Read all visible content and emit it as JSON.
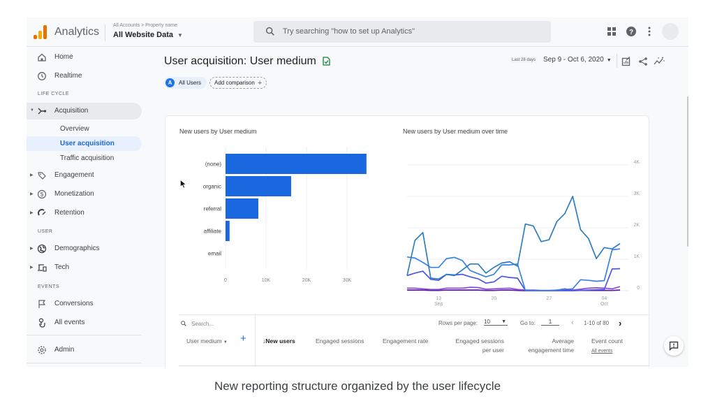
{
  "header": {
    "app_name": "Analytics",
    "breadcrumb": "All Accounts > Property name",
    "property_selector": "All Website Data",
    "search_placeholder": "Try searching \"how to set up Analytics\"",
    "icons": [
      "apps-grid-icon",
      "help-icon",
      "more-vert-icon",
      "account-avatar"
    ]
  },
  "sidebar": {
    "items_top": [
      {
        "label": "Home",
        "icon": "home-icon"
      },
      {
        "label": "Realtime",
        "icon": "clock-icon"
      }
    ],
    "section_lifecycle": "LIFE CYCLE",
    "acquisition": {
      "label": "Acquisition",
      "icon": "acquisition-icon",
      "expanded": true
    },
    "acquisition_children": [
      "Overview",
      "User acquisition",
      "Traffic acquisition"
    ],
    "selected": "User acquisition",
    "lifecycle_items": [
      {
        "label": "Engagement",
        "icon": "tag-icon"
      },
      {
        "label": "Monetization",
        "icon": "dollar-icon"
      },
      {
        "label": "Retention",
        "icon": "magnet-icon"
      }
    ],
    "section_user": "USER",
    "user_items": [
      {
        "label": "Demographics",
        "icon": "globe-icon"
      },
      {
        "label": "Tech",
        "icon": "devices-icon"
      }
    ],
    "section_events": "EVENTS",
    "event_items": [
      {
        "label": "Conversions",
        "icon": "flag-icon"
      },
      {
        "label": "All events",
        "icon": "touch-icon"
      }
    ],
    "admin": {
      "label": "Admin",
      "icon": "gear-icon"
    }
  },
  "page": {
    "title": "User acquisition: User medium",
    "segment_chip_letter": "A",
    "segment_chip": "All Users",
    "add_comparison": "Add comparison",
    "date_badge": "Last 28 days",
    "date_range": "Sep 9 - Oct 6, 2020"
  },
  "chart_data": [
    {
      "type": "bar",
      "orientation": "horizontal",
      "title": "New users by User medium",
      "categories": [
        "(none)",
        "organic",
        "referral",
        "affiliate",
        "email"
      ],
      "values": [
        34800,
        16200,
        8100,
        1000,
        50
      ],
      "xticks": [
        "0",
        "10K",
        "20K",
        "30K"
      ],
      "xlim": [
        0,
        35000
      ],
      "color": "#1a67e0",
      "grid": true
    },
    {
      "type": "line",
      "title": "New users by User medium over time",
      "x_start": "Sep 9",
      "x_ticks": [
        {
          "day": 4,
          "label": "13",
          "sub": "Sep"
        },
        {
          "day": 11,
          "label": "20",
          "sub": ""
        },
        {
          "day": 18,
          "label": "27",
          "sub": ""
        },
        {
          "day": 25,
          "label": "04",
          "sub": "Oct"
        }
      ],
      "yticks": [
        "0",
        "1K",
        "2K",
        "3K",
        "4K"
      ],
      "ylim": [
        0,
        4000
      ],
      "y_axis_side": "right",
      "legend_position": "bottom",
      "series": [
        {
          "name": "(none)",
          "color": "#2e7dbf",
          "values": [
            480,
            1600,
            1850,
            400,
            370,
            520,
            480,
            660,
            850,
            850,
            560,
            740,
            880,
            920,
            780,
            2120,
            2060,
            1560,
            1620,
            2200,
            2450,
            3000,
            1940,
            1660,
            1020,
            1370,
            1330,
            1500
          ]
        },
        {
          "name": "organic",
          "color": "#3883e6",
          "values": [
            1070,
            1040,
            900,
            740,
            740,
            1020,
            1060,
            960,
            640,
            540,
            440,
            520,
            820,
            820,
            850,
            10,
            0,
            0,
            0,
            20,
            40,
            60,
            350,
            330,
            300,
            320,
            1300,
            1330
          ]
        },
        {
          "name": "referral",
          "color": "#4a56e8",
          "values": [
            480,
            560,
            620,
            360,
            330,
            520,
            500,
            520,
            440,
            380,
            240,
            280,
            460,
            420,
            400,
            10,
            0,
            0,
            0,
            0,
            0,
            0,
            10,
            20,
            30,
            40,
            690,
            700
          ]
        },
        {
          "name": "affiliate",
          "color": "#8a4be0",
          "values": [
            80,
            80,
            60,
            40,
            40,
            80,
            80,
            80,
            110,
            100,
            50,
            60,
            70,
            80,
            40,
            20,
            20,
            10,
            10,
            20,
            60,
            20,
            50,
            80,
            90,
            80,
            60,
            130
          ]
        },
        {
          "name": "email",
          "color": "#5a1d9c",
          "values": [
            20,
            20,
            20,
            10,
            10,
            20,
            20,
            20,
            20,
            20,
            10,
            10,
            20,
            20,
            10,
            0,
            0,
            0,
            0,
            10,
            30,
            10,
            10,
            10,
            10,
            10,
            10,
            20
          ]
        }
      ]
    }
  ],
  "table": {
    "search_placeholder": "Search...",
    "rows_per_page_label": "Rows per page:",
    "rows_per_page_value": "10",
    "go_to_label": "Go to:",
    "go_to_value": "1",
    "pagination": "1-10 of 80",
    "dimension_header": "User medium",
    "columns": [
      "New users",
      "Engaged sessions",
      "Engagement rate",
      "Engaged sessions per user",
      "Average engagement time",
      "Event count"
    ],
    "sorted_column": "New users",
    "event_count_filter": "All events"
  },
  "caption": "New reporting structure organized by the user lifecycle"
}
